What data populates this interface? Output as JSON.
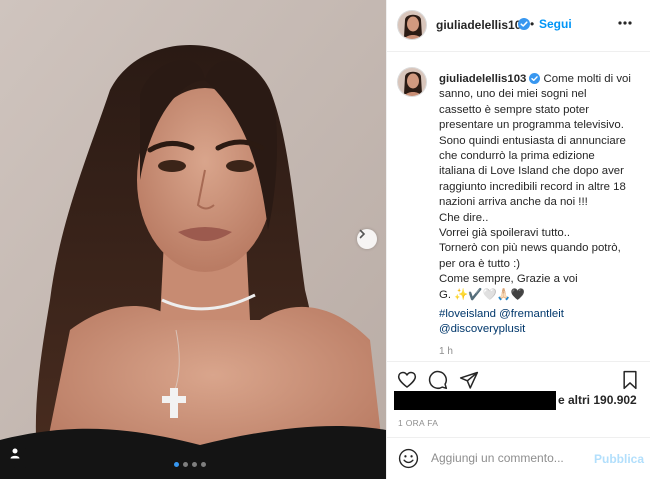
{
  "post": {
    "username": "giuliadelellis103",
    "follow_separator": "•",
    "follow_label": "Segui",
    "caption_lines": [
      "Come molti di voi",
      "sanno, uno dei miei sogni nel",
      "cassetto è sempre stato poter",
      "presentare un programma televisivo.",
      "Sono quindi entusiasta di annunciare",
      "che condurrò la prima edizione",
      "italiana di Love Island che dopo aver",
      "raggiunto incredibili record in altre 18",
      "nazioni arriva anche da noi !!!",
      "Che dire..",
      "Vorrei già spoileravi tutto..",
      "Tornerò con più news quando potrò,",
      "per ora è tutto :)",
      "Come sempre, Grazie a voi",
      "G. ✨✔️🤍🙏🏻🖤"
    ],
    "hashtags": [
      "#loveisland @fremantleit",
      "@discoveryplusit"
    ],
    "caption_time": "1 h",
    "likes_text": "e altri 190.902",
    "post_time": "1 ORA FA",
    "comment_placeholder": "Aggiungi un commento...",
    "publish_label": "Pubblica",
    "carousel": {
      "total": 4,
      "active": 1
    }
  },
  "colors": {
    "accent_blue": "#0095f6",
    "verified_blue": "#3897f0",
    "publish_disabled": "#b2dffc",
    "muted": "#8e8e8e"
  },
  "icons": [
    "verified-icon",
    "more-options-icon",
    "heart-icon",
    "comment-icon",
    "share-icon",
    "bookmark-icon",
    "emoji-icon",
    "next-arrow-icon",
    "user-tag-icon"
  ]
}
